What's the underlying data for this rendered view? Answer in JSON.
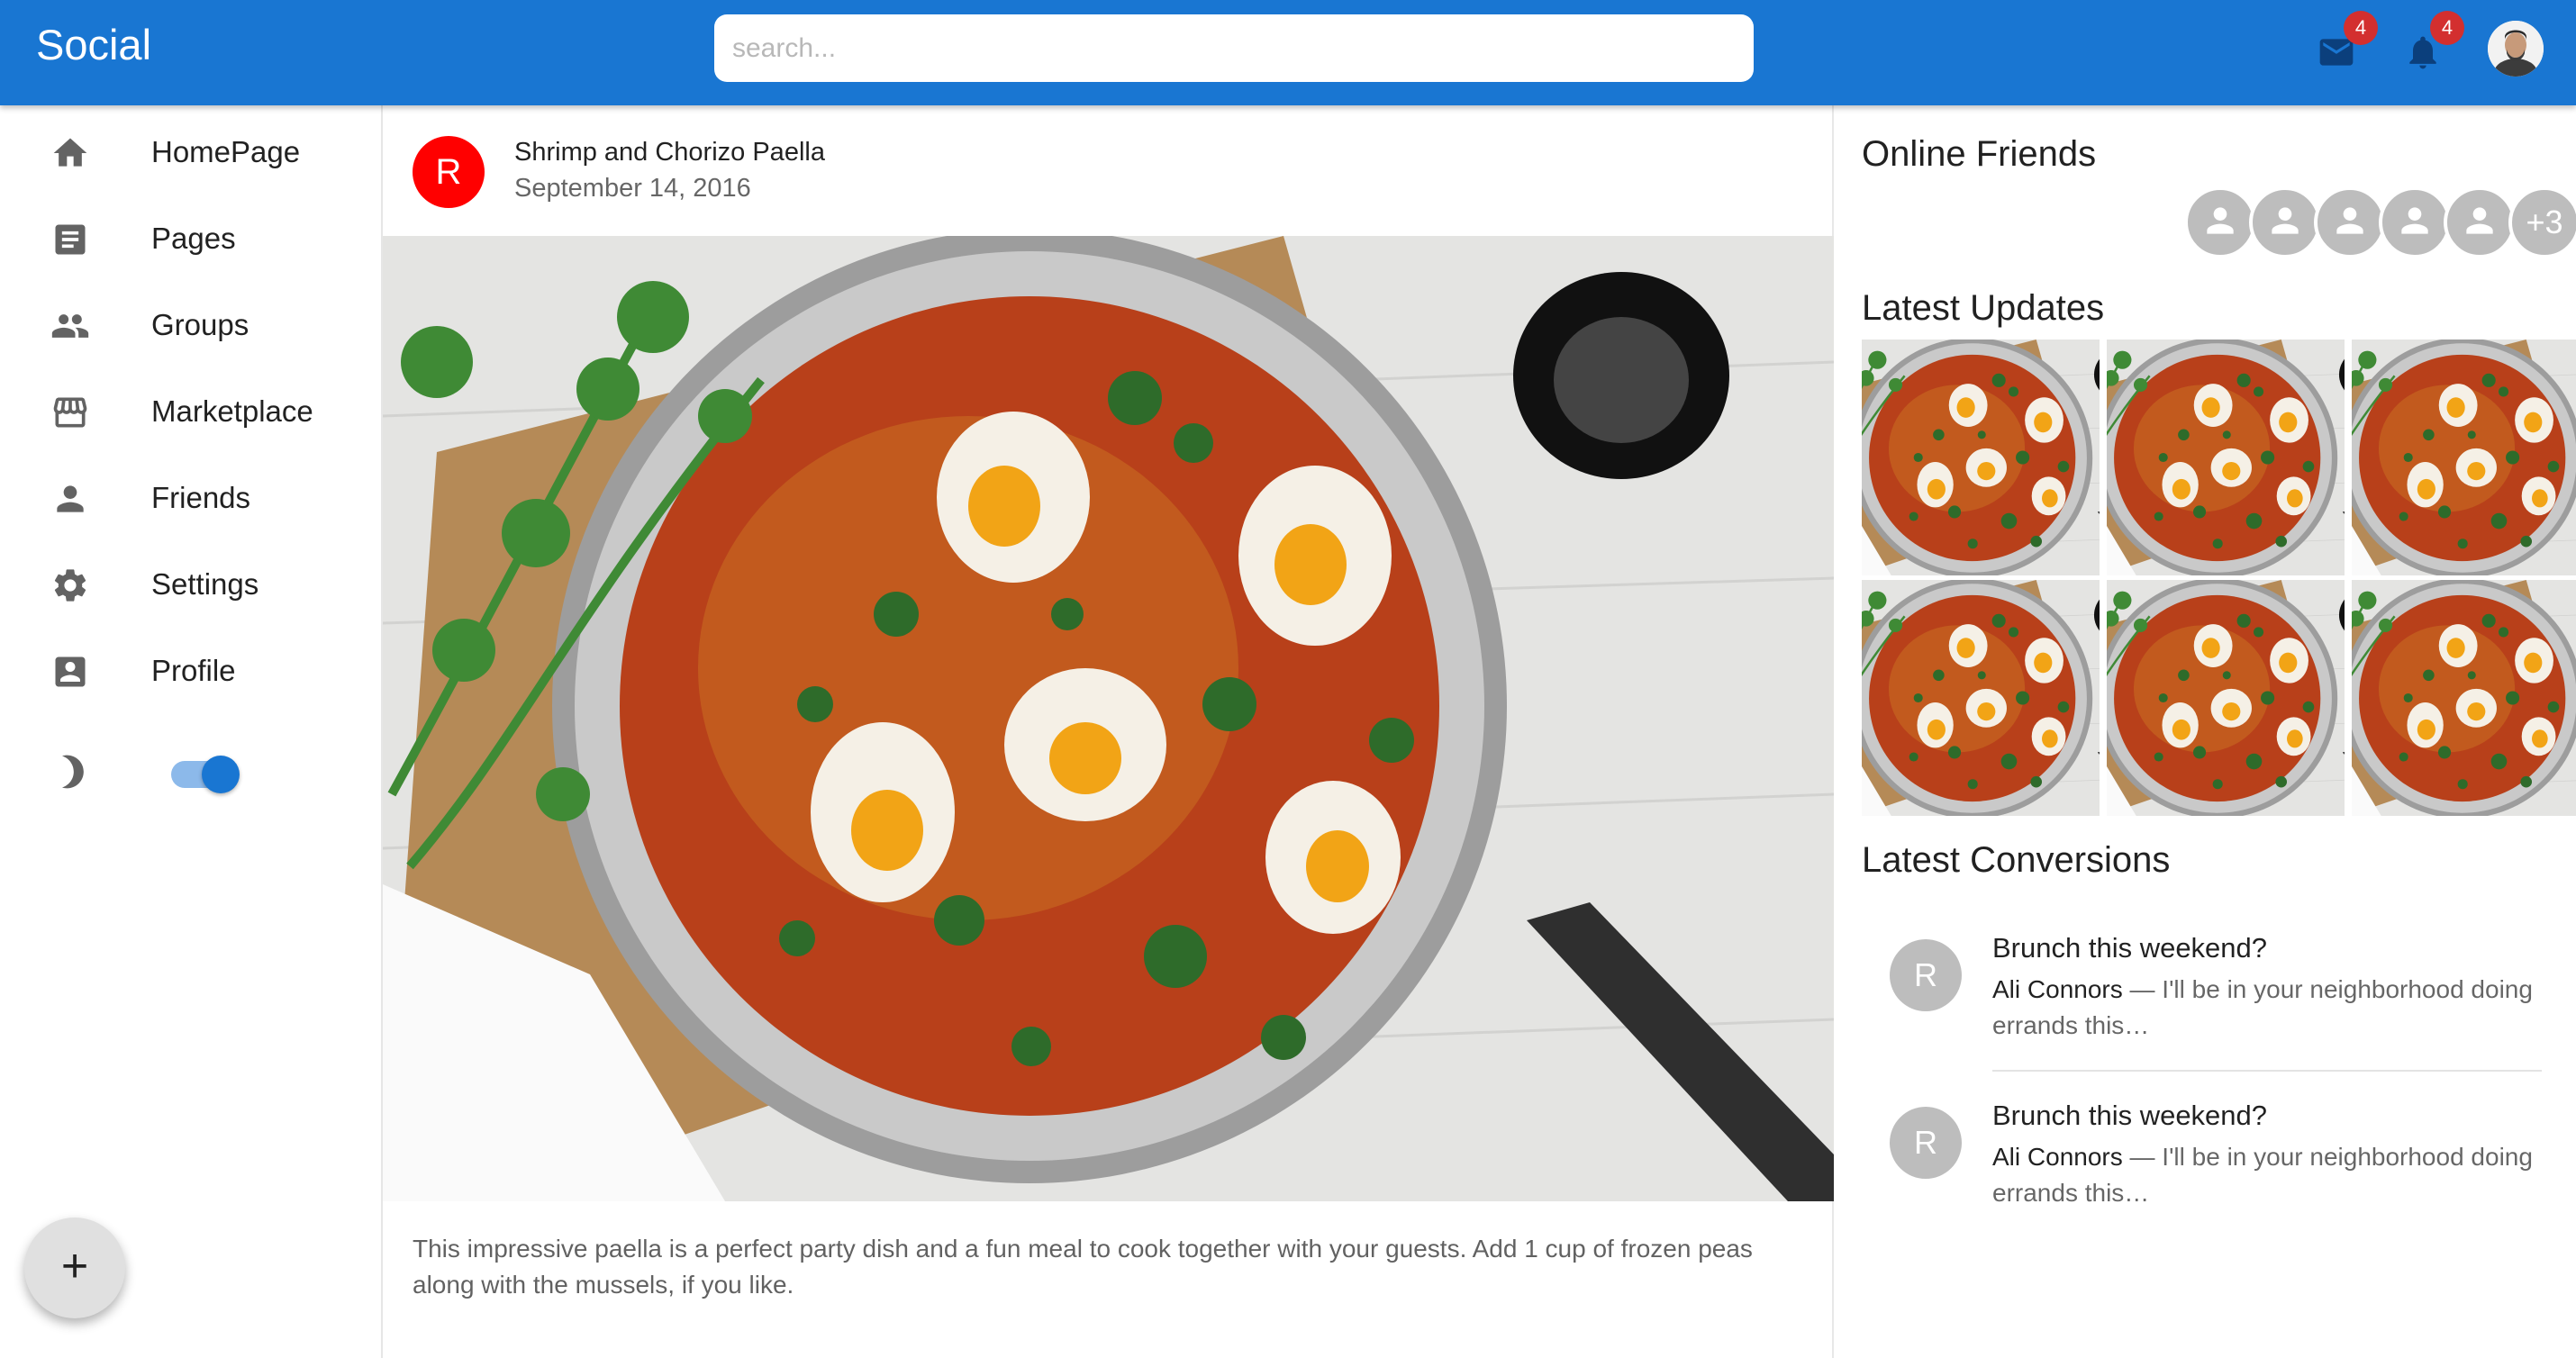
{
  "appbar": {
    "brand": "Social",
    "search_placeholder": "search...",
    "mail_badge": "4",
    "notifications_badge": "4"
  },
  "sidebar": {
    "items": [
      {
        "label": "HomePage",
        "icon": "home-icon"
      },
      {
        "label": "Pages",
        "icon": "article-icon"
      },
      {
        "label": "Groups",
        "icon": "group-icon"
      },
      {
        "label": "Marketplace",
        "icon": "storefront-icon"
      },
      {
        "label": "Friends",
        "icon": "person-icon"
      },
      {
        "label": "Settings",
        "icon": "gear-icon"
      },
      {
        "label": "Profile",
        "icon": "account-box-icon"
      }
    ],
    "dark_mode_enabled": true
  },
  "fab": {
    "label": "+"
  },
  "post": {
    "avatar_letter": "R",
    "title": "Shrimp and Chorizo Paella",
    "date": "September 14, 2016",
    "body": "This impressive paella is a perfect party dish and a fun meal to cook together with your guests. Add 1 cup of frozen peas along with the mussels, if you like."
  },
  "right": {
    "online_friends_title": "Online Friends",
    "online_friends_more": "+3",
    "latest_updates_title": "Latest Updates",
    "latest_conversions_title": "Latest Conversions",
    "conversations": [
      {
        "avatar": "R",
        "title": "Brunch this weekend?",
        "sender": "Ali Connors",
        "preview": " — I'll be in your neighborhood doing errands this…"
      },
      {
        "avatar": "R",
        "title": "Brunch this weekend?",
        "sender": "Ali Connors",
        "preview": " — I'll be in your neighborhood doing errands this…"
      }
    ]
  },
  "colors": {
    "appbar": "#1976d2",
    "post_avatar": "#ff0000",
    "badge": "#d32f2f"
  }
}
